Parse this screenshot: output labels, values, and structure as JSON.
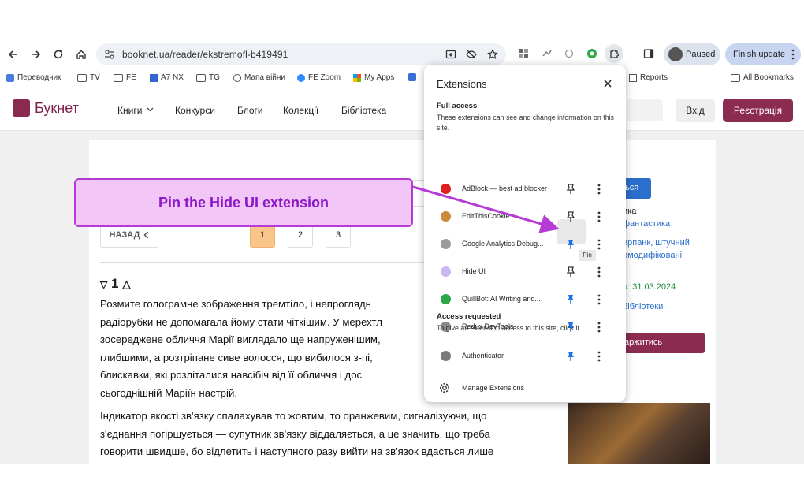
{
  "browser": {
    "url": "booknet.ua/reader/ekstremofl-b419491",
    "profile_label": "Paused",
    "update_label": "Finish update"
  },
  "bookmarks": {
    "items": [
      "Переводчик",
      "TV",
      "FE",
      "A7 NX",
      "TG",
      "Мапа війни",
      "FE Zoom",
      "My Apps"
    ],
    "reports": "Reports",
    "all": "All Bookmarks"
  },
  "site": {
    "logo": "Букнет",
    "nav": [
      "Книги",
      "Конкурси",
      "Блоги",
      "Колекції",
      "Бібліотека"
    ],
    "login": "Вхід",
    "register": "Реєстрація"
  },
  "reader": {
    "chapter_select": "1 △",
    "back": "НАЗАД",
    "pages": [
      "1",
      "2",
      "3"
    ],
    "chapter_title": "1",
    "para1_lines": [
      "Розмите голограмне зображення тремтіло, і непроглядн",
      "радіорубки не допомагала йому стати чіткішим. У мерехтл",
      "зосереджене обличчя Марії виглядало ще напруженішим,",
      "глибшими, а розтріпане сиве волосся, що вибилося з-пі,",
      "блискавки, які розліталися навсібіч від її обличчя і дос",
      "сьогоднішній Маріїн настрій."
    ],
    "para2_lines": [
      "Індикатор якості зв'язку спалахував то жовтим, то оранжевим, сигналізуючи, що",
      "з'єднання погіршується — супутник зв'язку віддаляється, а це значить, що треба",
      "говорити швидше, бо відлетить і наступного разу вийти на зв'язок вдасться лише"
    ]
  },
  "sidebar": {
    "button1": "ться",
    "lines": [
      "ика",
      "фантастика",
      "ерпанк, штучний",
      "омодифіковані",
      "о: 31.03.2024",
      "бібліотеки"
    ],
    "button2": "аржитись"
  },
  "extensions": {
    "title": "Extensions",
    "full_access_heading": "Full access",
    "full_access_desc": "These extensions can see and change information on this site.",
    "full_access": [
      {
        "name": "AdBlock — best ad blocker",
        "pinned": false,
        "color": "#e02020"
      },
      {
        "name": "EditThisCookie",
        "pinned": false,
        "color": "#c98a3a"
      },
      {
        "name": "Google Analytics Debug...",
        "pinned": true,
        "color": "#9a9a9a"
      },
      {
        "name": "Hide UI",
        "pinned": false,
        "color": "#c9b6f2"
      },
      {
        "name": "QuillBot: AI Writing and...",
        "pinned": true,
        "color": "#2aa84a"
      },
      {
        "name": "Redux DevTools",
        "pinned": true,
        "color": "#8a8a8a"
      }
    ],
    "access_requested_heading": "Access requested",
    "access_requested_desc": "To give an extension access to this site, click it.",
    "access_requested": [
      {
        "name": "Authenticator",
        "pinned": true,
        "color": "#7a7a7a"
      }
    ],
    "pin_tooltip": "Pin",
    "manage": "Manage Extensions",
    "pin_color": "#1a73e8"
  },
  "annotation": {
    "text": "Pin the Hide UI extension",
    "color": "#b63ad6"
  }
}
